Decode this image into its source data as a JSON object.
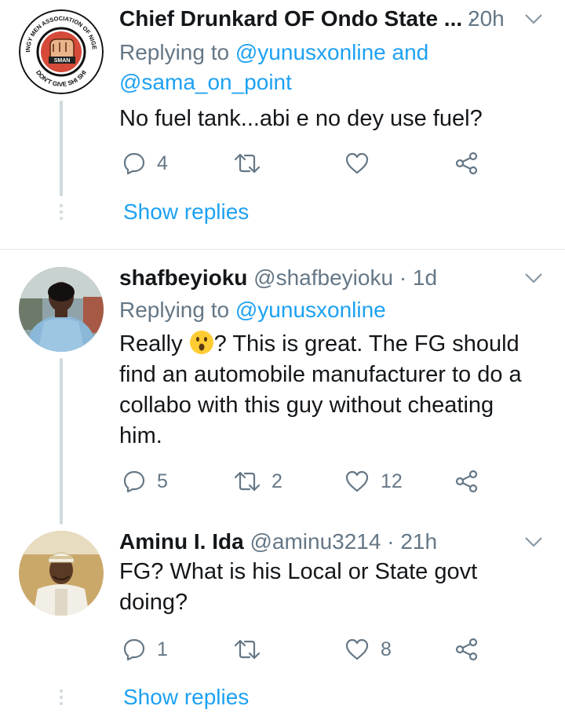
{
  "tweets": [
    {
      "name": "Chief Drunkard OF Ondo State ...",
      "handle": "",
      "time": "20h",
      "replying_prefix": "Replying to ",
      "mentions_line1": "@yunusxonline and",
      "mentions_line2": "@sama_on_point",
      "text": "No fuel tank...abi e no dey use fuel?",
      "reply_count": "4",
      "retweet_count": "",
      "like_count": "",
      "show_replies": "Show replies",
      "avatar_text_top": "STINGY MEN ASSOCIATION OF NIGERIA",
      "avatar_text_mid": "SMAN",
      "avatar_text_bottom": "DON'T GIVE SHI SHI"
    },
    {
      "name": "shafbeyioku",
      "handle": "@shafbeyioku",
      "time": "1d",
      "replying_prefix": "Replying to ",
      "mentions_line1": "@yunusxonline",
      "text_before_emoji": "Really ",
      "text_after_emoji": "? This is great. The FG should",
      "text_line2": "find an automobile manufacturer to do a",
      "text_line3": "collabo with this guy without cheating",
      "text_line4": "him.",
      "reply_count": "5",
      "retweet_count": "2",
      "like_count": "12"
    },
    {
      "name": "Aminu I. Ida",
      "handle": "@aminu3214",
      "time": "21h",
      "text_line1": "FG? What is his Local or State govt",
      "text_line2": "doing?",
      "reply_count": "1",
      "retweet_count": "",
      "like_count": "8",
      "show_replies": "Show replies"
    }
  ],
  "separator": "·",
  "colors": {
    "accent": "#1da1f2",
    "muted": "#657786",
    "text": "#14171a",
    "line": "#cfd9de"
  }
}
